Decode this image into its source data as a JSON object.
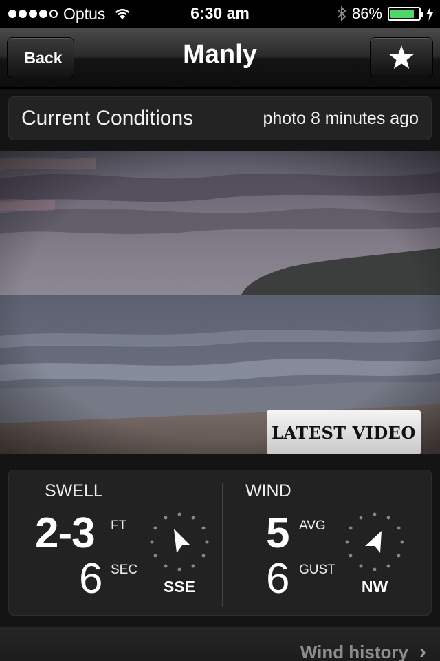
{
  "status_bar": {
    "carrier": "Optus",
    "time": "6:30 am",
    "battery_percent": "86%",
    "battery_level": 0.86,
    "signal_bars": 4
  },
  "nav": {
    "back_label": "Back",
    "title": "Manly",
    "favorite_icon": "star-icon"
  },
  "conditions": {
    "title": "Current Conditions",
    "photo_age": "photo 8 minutes ago",
    "video_button": "LATEST VIDEO"
  },
  "swell": {
    "label": "SWELL",
    "height": "2-3",
    "height_unit": "FT",
    "period": "6",
    "period_unit": "SEC",
    "direction": "SSE"
  },
  "wind": {
    "label": "WIND",
    "avg": "5",
    "avg_unit": "AVG",
    "gust": "6",
    "gust_unit": "GUST",
    "direction": "NW"
  },
  "footer": {
    "link": "Wind history"
  },
  "colors": {
    "battery": "#4cd964",
    "panel": "#222222",
    "background": "#141414"
  }
}
